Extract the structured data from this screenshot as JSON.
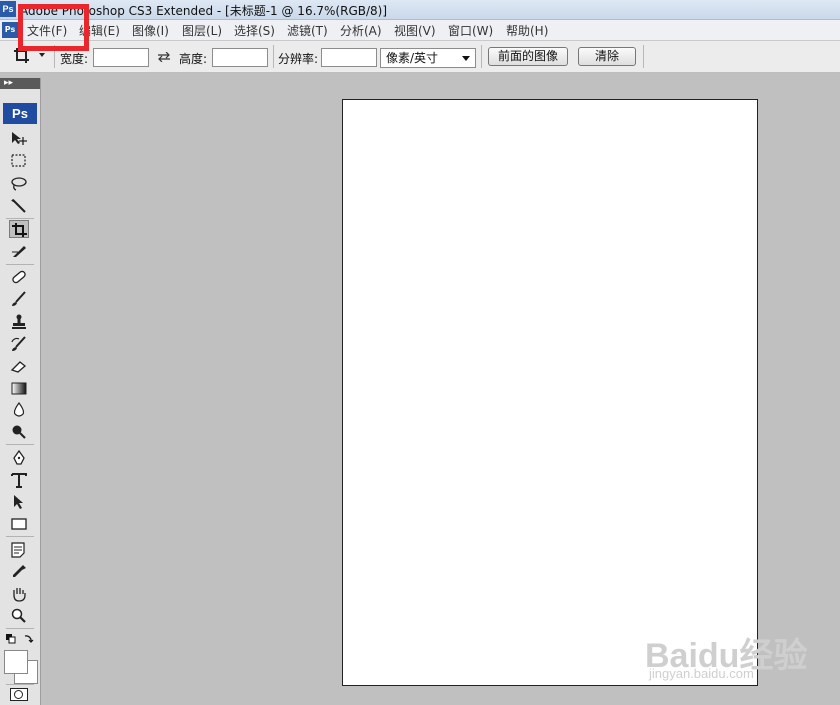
{
  "window": {
    "title": "Adobe Photoshop CS3 Extended - [未标题-1 @ 16.7%(RGB/8)]",
    "app_icon": "Ps"
  },
  "menu": {
    "items": [
      "文件(F)",
      "编辑(E)",
      "图像(I)",
      "图层(L)",
      "选择(S)",
      "滤镜(T)",
      "分析(A)",
      "视图(V)",
      "窗口(W)",
      "帮助(H)"
    ]
  },
  "options": {
    "width_label": "宽度:",
    "width_value": "",
    "height_label": "高度:",
    "height_value": "",
    "resolution_label": "分辨率:",
    "resolution_value": "",
    "unit": "像素/英寸",
    "front_image_button": "前面的图像",
    "clear_button": "清除"
  },
  "toolbox": {
    "logo": "Ps",
    "active_tool": "crop-tool"
  },
  "watermark": {
    "main": "Baidu经验",
    "sub": "jingyan.baidu.com"
  },
  "colors": {
    "highlight": "#e8262b",
    "workspace": "#c0c0c0",
    "canvas": "#ffffff"
  }
}
